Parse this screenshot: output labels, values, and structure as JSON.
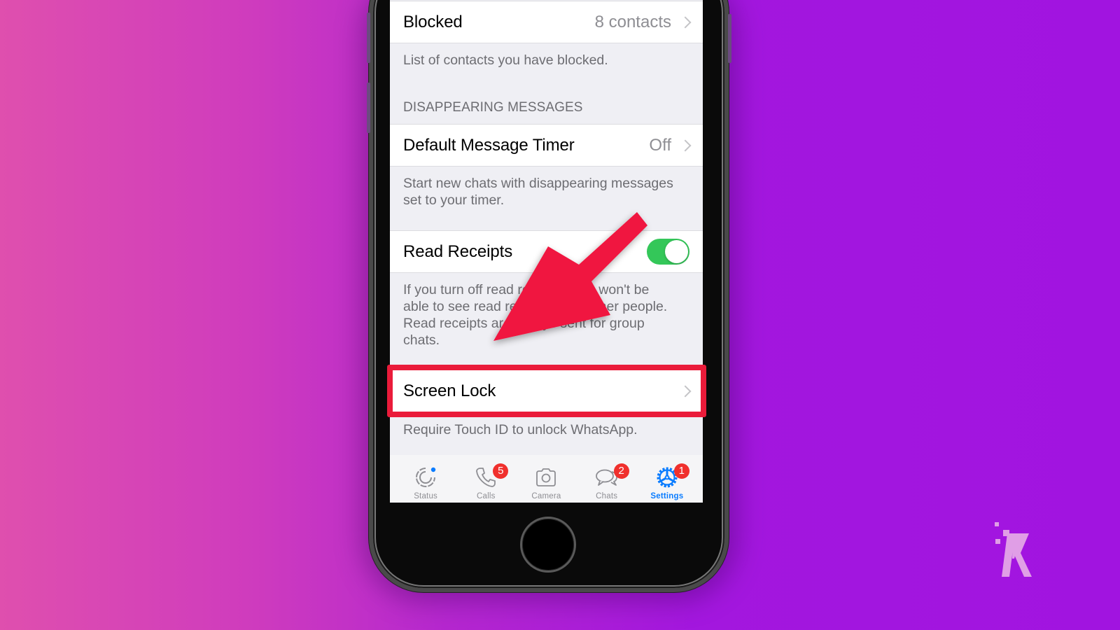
{
  "background": {
    "gradient_left": "#df4fae",
    "gradient_right": "#a114e0"
  },
  "settings": {
    "blocked": {
      "label": "Blocked",
      "value": "8 contacts",
      "footer": "List of contacts you have blocked."
    },
    "disappearing_section_header": "DISAPPEARING MESSAGES",
    "default_timer": {
      "label": "Default Message Timer",
      "value": "Off",
      "footer_line1": "Start new chats with disappearing messages",
      "footer_line2": "set to your timer."
    },
    "read_receipts": {
      "label": "Read Receipts",
      "enabled": true,
      "footer_line1": "If you turn off read receipts, you won't be",
      "footer_line2": "able to see read receipts from other people.",
      "footer_line3": "Read receipts are always sent for group",
      "footer_line4": "chats."
    },
    "screen_lock": {
      "label": "Screen Lock",
      "footer": "Require Touch ID to unlock WhatsApp.",
      "highlighted": true
    }
  },
  "tabbar": {
    "tabs": [
      {
        "label": "Status",
        "icon": "status-icon",
        "badge": null,
        "dot": true,
        "active": false
      },
      {
        "label": "Calls",
        "icon": "phone-icon",
        "badge": "5",
        "active": false
      },
      {
        "label": "Camera",
        "icon": "camera-icon",
        "badge": null,
        "active": false
      },
      {
        "label": "Chats",
        "icon": "chat-bubbles-icon",
        "badge": "2",
        "active": false
      },
      {
        "label": "Settings",
        "icon": "gear-icon",
        "badge": "1",
        "active": true
      }
    ]
  },
  "colors": {
    "highlight_box": "#ea1b3a",
    "arrow": "#f0173f",
    "toggle_on": "#34c759",
    "active_tab": "#0a7cff",
    "badge": "#f0302d"
  },
  "watermark": {
    "letter": "K"
  }
}
